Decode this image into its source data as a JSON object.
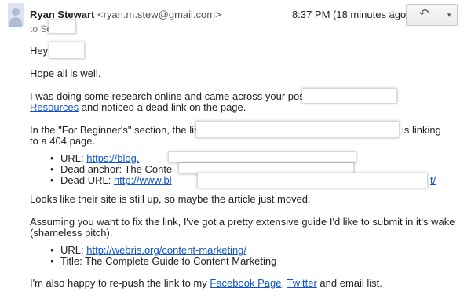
{
  "header": {
    "sender_name": "Ryan Stewart",
    "sender_email": "<ryan.m.stew@gmail.com>",
    "time": "8:37 PM (18 minutes ago)",
    "to_line": "to Se",
    "star_icon": "☆",
    "reply_icon": "↶",
    "more_icon": "▾"
  },
  "body": {
    "greeting": "Hey",
    "line1": "Hope all is well.",
    "line2a": "I was doing some research online and came across your post",
    "line2b_link": "Resources",
    "line2b_rest": "and noticed a dead link on the page.",
    "line3a_pre": "In the \"For Beginner's\" section, the link",
    "line3a_post": "is linking",
    "line3b": "to a 404 page.",
    "bullets1": [
      {
        "label": "URL:",
        "value": "https://blog."
      },
      {
        "label": "Dead anchor:",
        "value": "The Conte"
      },
      {
        "label": "Dead URL:",
        "value": "http://www.bl",
        "tail": "t/"
      }
    ],
    "line4": "Looks like their site is still up, so maybe the article just moved.",
    "line5a": "Assuming you want to fix the link, I've got a pretty extensive guide I'd like to submit in it's wake",
    "line5b": "(shameless pitch).",
    "bullets2": [
      {
        "label": "URL:",
        "value": "http://webris.org/content-marketing/"
      },
      {
        "label": "Title:",
        "value": "The Complete Guide to Content Marketing"
      }
    ],
    "line6_pre": "I'm also happy to re-push the link to my",
    "link_facebook": "Facebook Page",
    "comma": ",",
    "link_twitter": "Twitter",
    "line6_post": "and email list."
  }
}
